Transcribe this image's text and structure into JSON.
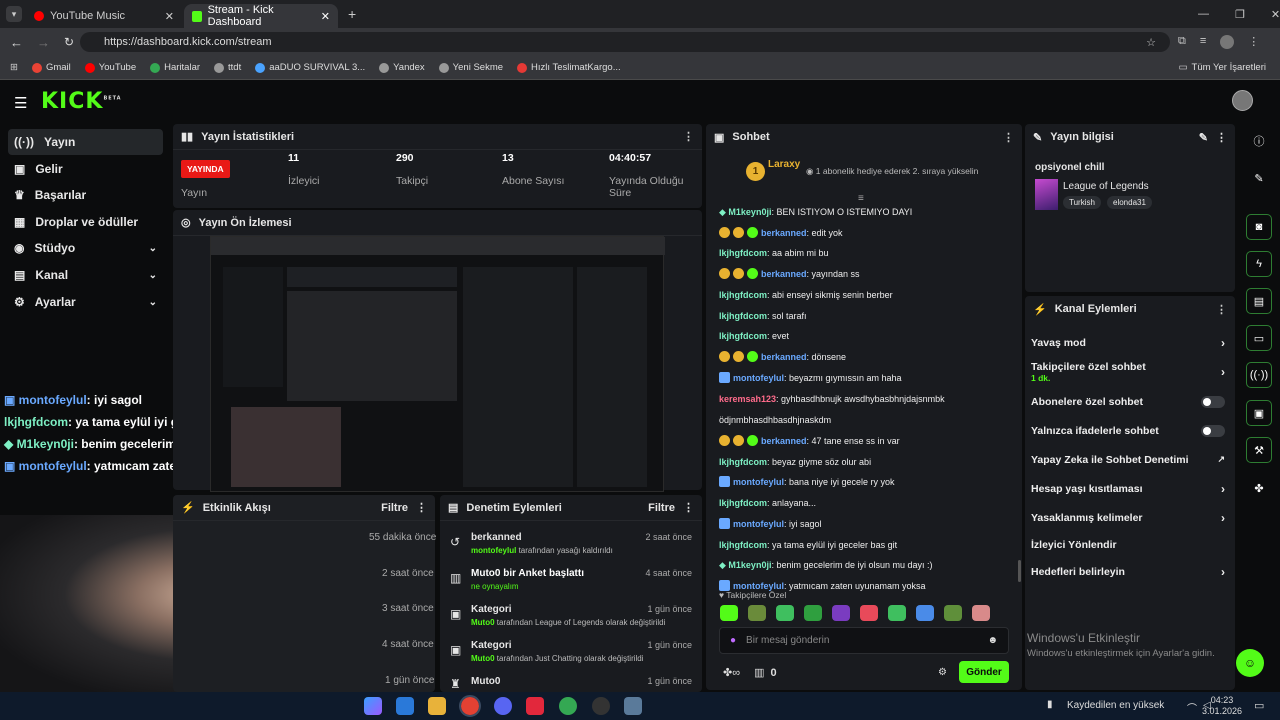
{
  "browser": {
    "tabs": [
      {
        "title": "YouTube Music"
      },
      {
        "title": "Stream - Kick Dashboard"
      }
    ],
    "url": "https://dashboard.kick.com/stream",
    "bookmarks": [
      "Gmail",
      "YouTube",
      "Haritalar",
      "ttdt",
      "aaDUO SURVIVAL 3...",
      "Yandex",
      "Yeni Sekme",
      "Hızlı TeslimatKargo..."
    ],
    "all_bookmarks": "Tüm Yer İşaretleri"
  },
  "logo": "KICK",
  "logo_sup": "BETA",
  "sidebar": [
    {
      "label": "Yayın"
    },
    {
      "label": "Gelir"
    },
    {
      "label": "Başarılar"
    },
    {
      "label": "Droplar ve ödüller"
    },
    {
      "label": "Stüdyo"
    },
    {
      "label": "Kanal"
    },
    {
      "label": "Ayarlar"
    }
  ],
  "stats": {
    "title": "Yayın İstatistikleri",
    "live": "YAYINDA",
    "live_label": "Yayın",
    "viewers": "11",
    "viewers_label": "İzleyici",
    "followers": "290",
    "followers_label": "Takipçi",
    "subs": "13",
    "subs_label": "Abone Sayısı",
    "uptime": "04:40:57",
    "uptime_label": "Yayında Olduğu Süre"
  },
  "preview_title": "Yayın Ön İzlemesi",
  "overlay_chat": [
    {
      "user": "montofeylul",
      "text": ": iyi sagol",
      "color": "#6aa9ff"
    },
    {
      "user": "lkjhgfdcom",
      "text": ": ya tama eylül iyi geceler bas git",
      "color": "#7ef0c4"
    },
    {
      "user": "M1keyn0ji",
      "text": ": benim gecelerim de iyi olsun mu dayı :)",
      "color": "#7ef0c4"
    },
    {
      "user": "montofeylul",
      "text": ": yatmıcam zaten uyunamam yoksa",
      "color": "#6aa9ff"
    }
  ],
  "activity": {
    "title": "Etkinlik Akışı",
    "filter": "Filtre",
    "times": [
      "55 dakika önce",
      "2 saat önce",
      "3 saat önce",
      "4 saat önce",
      "1 gün önce"
    ]
  },
  "moderation": {
    "title": "Denetim Eylemleri",
    "filter": "Filtre",
    "items": [
      {
        "title": "berkanned",
        "sub_user": "montofeylul",
        "sub": " tarafından yasağı kaldırıldı",
        "time": "2 saat önce"
      },
      {
        "title": "Muto0 bir Anket başlattı",
        "sub_user": "",
        "sub": "ne oynayalım",
        "time": "4 saat önce"
      },
      {
        "title": "Kategori",
        "sub_user": "Muto0",
        "sub": " tarafından League of Legends olarak değiştirildi",
        "time": "1 gün önce"
      },
      {
        "title": "Kategori",
        "sub_user": "Muto0",
        "sub": " tarafından Just Chatting olarak değiştirildi",
        "time": "1 gün önce"
      },
      {
        "title": "Muto0",
        "sub_user": "",
        "sub": "",
        "time": "1 gün önce"
      }
    ]
  },
  "chat": {
    "title": "Sohbet",
    "pinned_user": "Laraxy",
    "pinned_count": "1",
    "pinned_msg": "1 abonelik hediye ederek 2. sıraya yükselin",
    "messages": [
      {
        "user": "M1keyn0ji",
        "text": ": BEN ISTIYOM O ISTEMIYO DAYI",
        "color": "#7ef0c4"
      },
      {
        "user": "berkanned",
        "text": ": edit yok",
        "color": "#6aa9ff"
      },
      {
        "user": "lkjhgfdcom",
        "text": ": aa abim mi bu",
        "color": "#7ef0c4"
      },
      {
        "user": "berkanned",
        "text": ": yayından ss",
        "color": "#6aa9ff"
      },
      {
        "user": "lkjhgfdcom",
        "text": ": abi enseyi sikmiş senin berber",
        "color": "#7ef0c4"
      },
      {
        "user": "lkjhgfdcom",
        "text": ": sol tarafı",
        "color": "#7ef0c4"
      },
      {
        "user": "lkjhgfdcom",
        "text": ": evet",
        "color": "#7ef0c4"
      },
      {
        "user": "berkanned",
        "text": ": dönsene",
        "color": "#6aa9ff"
      },
      {
        "user": "montofeylul",
        "text": ": beyazmı gıymıssın am haha",
        "color": "#6aa9ff"
      },
      {
        "user": "keremsah123",
        "text": ": gyhbasdhbnujk awsdhybasbhnjdajsnmbk",
        "color": "#ff6b8b"
      },
      {
        "user": "",
        "text": "ödjnmbhasdhbasdhjnaskdm",
        "color": "#ff6b8b"
      },
      {
        "user": "berkanned",
        "text": ": 47 tane ense ss in var",
        "color": "#6aa9ff"
      },
      {
        "user": "lkjhgfdcom",
        "text": ": beyaz giyme söz olur abi",
        "color": "#7ef0c4"
      },
      {
        "user": "montofeylul",
        "text": ": bana niye iyi gecele ry yok",
        "color": "#6aa9ff"
      },
      {
        "user": "lkjhgfdcom",
        "text": ": anlayana...",
        "color": "#7ef0c4"
      },
      {
        "user": "montofeylul",
        "text": ": iyi sagol",
        "color": "#6aa9ff"
      },
      {
        "user": "lkjhgfdcom",
        "text": ": ya tama eylül iyi geceler bas git",
        "color": "#7ef0c4"
      },
      {
        "user": "M1keyn0ji",
        "text": ": benim gecelerim de iyi olsun mu dayı :)",
        "color": "#7ef0c4"
      },
      {
        "user": "montofeylul",
        "text": ": yatmıcam zaten uyunamam yoksa",
        "color": "#6aa9ff"
      }
    ],
    "followers_only": "Takipçilere Özel",
    "input_placeholder": "Bir mesaj gönderin",
    "send": "Gönder",
    "points": "0"
  },
  "stream_info": {
    "title": "Yayın bilgisi",
    "stream_title": "opsiyonel chill",
    "category": "League of Legends",
    "tags": [
      "Turkish",
      "elonda31"
    ]
  },
  "channel_actions": {
    "title": "Kanal Eylemleri",
    "items": [
      {
        "label": "Yavaş mod",
        "sub": ""
      },
      {
        "label": "Takipçilere özel sohbet",
        "sub": "1 dk."
      },
      {
        "label": "Abonelere özel sohbet",
        "sub": ""
      },
      {
        "label": "Yalnızca ifadelerle sohbet",
        "sub": ""
      },
      {
        "label": "Yapay Zeka ile Sohbet Denetimi",
        "sub": ""
      },
      {
        "label": "Hesap yaşı kısıtlaması",
        "sub": ""
      },
      {
        "label": "Yasaklanmış kelimeler",
        "sub": ""
      },
      {
        "label": "İzleyici Yönlendir",
        "sub": ""
      },
      {
        "label": "Hedefleri belirleyin",
        "sub": ""
      }
    ]
  },
  "windows": {
    "activate_title": "Windows'u Etkinleştir",
    "activate_sub": "Windows'u etkinleştirmek için Ayarlar'a gidin.",
    "saved": "Kaydedilen en yüksek",
    "time": "04:23",
    "date": "3.01.2026"
  },
  "colors": {
    "kick_green": "#53fc18",
    "live_red": "#e91916"
  }
}
